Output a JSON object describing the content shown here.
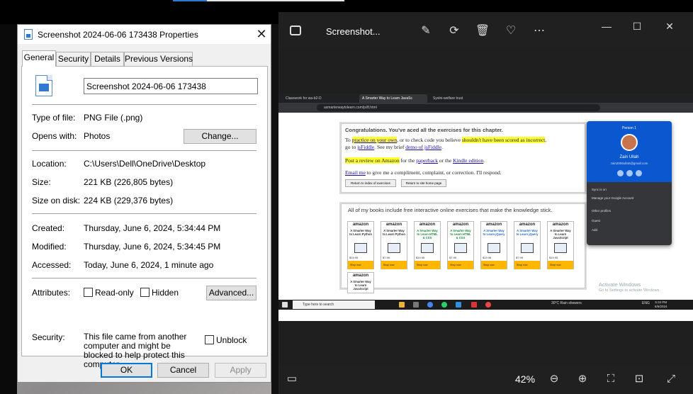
{
  "properties": {
    "title": "Screenshot 2024-06-06 173438 Properties",
    "tabs": [
      {
        "label": "General"
      },
      {
        "label": "Security"
      },
      {
        "label": "Details"
      },
      {
        "label": "Previous Versions"
      }
    ],
    "file_name": "Screenshot 2024-06-06 173438",
    "type_label": "Type of file:",
    "type_value": "PNG File (.png)",
    "opens_label": "Opens with:",
    "opens_value": "Photos",
    "change_button": "Change...",
    "location_label": "Location:",
    "location_value": "C:\\Users\\Dell\\OneDrive\\Desktop",
    "size_label": "Size:",
    "size_value": "221 KB (226,805 bytes)",
    "size_disk_label": "Size on disk:",
    "size_disk_value": "224 KB (229,376 bytes)",
    "created_label": "Created:",
    "created_value": "Thursday, June 6, 2024, 5:34:44 PM",
    "modified_label": "Modified:",
    "modified_value": "Thursday, June 6, 2024, 5:34:45 PM",
    "accessed_label": "Accessed:",
    "accessed_value": "Today, June 6, 2024, 1 minute ago",
    "attributes_label": "Attributes:",
    "readonly_label": "Read-only",
    "hidden_label": "Hidden",
    "advanced_button": "Advanced...",
    "security_label": "Security:",
    "security_text": "This file came from another computer and might be blocked to help protect this computer.",
    "unblock_label": "Unblock",
    "ok_button": "OK",
    "cancel_button": "Cancel",
    "apply_button": "Apply",
    "accent_color": "#0078d7"
  },
  "viewer": {
    "title": "Screenshot...",
    "zoom": "42%",
    "icons": [
      "image-icon",
      "edit-icon",
      "rotate-icon",
      "delete-icon",
      "favorite-icon",
      "more-icon",
      "minimize-icon",
      "maximize-icon",
      "close-icon",
      "filmstrip-icon",
      "zoom-out-icon",
      "zoom-in-icon",
      "fit-icon",
      "actual-size-icon",
      "fullscreen-icon"
    ],
    "shot": {
      "tabs": [
        "Classwork for wa-b2-D",
        "A Smarter Way to Learn JavaSc",
        "Syslni-welfare trust"
      ],
      "url": "asmarterwaytolearn.com/js/8.html",
      "card1": {
        "heading": "Congratulations. You've aced all the exercises for this chapter.",
        "to": "To",
        "practice": "practice on your own",
        "or_check": ", or to check code you believe",
        "incorrect": "shouldn't have been scored as incorrect",
        "goto": "go to",
        "jsfiddle": "jsFiddle",
        "see_brief": ". See my brief",
        "demo": "demo of jsFiddle",
        "review": "Post a review on Amazon",
        "for_the": "for the",
        "paperback": "paperback",
        "or_the": "or the",
        "kindle": "Kindle edition",
        "email": "Email me",
        "email_rest": "to give me a compliment, complaint, or correction. I'll respond.",
        "btn_index": "Return to index of exercises",
        "btn_home": "Return to site home page"
      },
      "card2": {
        "heading": "All of my books include free interactive online exercises that make the knowledge stick.",
        "books": [
          {
            "brand": "amazon",
            "title": "A Smarter Way to Learn Python",
            "price": "$19.95",
            "shop": "Shop now"
          },
          {
            "brand": "amazon",
            "title": "A Smarter Way to Learn Python",
            "price": "$7.99",
            "shop": "Shop now"
          },
          {
            "brand": "amazon",
            "title": "A Smarter Way to Learn HTML & CSS",
            "price": "$19.95",
            "shop": "Shop now"
          },
          {
            "brand": "amazon",
            "title": "A Smarter Way to Learn HTML & CSS",
            "price": "$7.99",
            "shop": "Shop now"
          },
          {
            "brand": "amazon",
            "title": "A Smarter Way to Learn jQuery",
            "price": "$19.95",
            "shop": "Shop now"
          },
          {
            "brand": "amazon",
            "title": "A Smarter Way to Learn jQuery",
            "price": "$7.99",
            "shop": "Shop now"
          },
          {
            "brand": "amazon",
            "title": "A Smarter Way to Learn JavaScript",
            "price": "$19.95",
            "shop": "Shop now"
          },
          {
            "brand": "amazon",
            "title": "A Smarter Way to Learn JavaScript",
            "price": "",
            "shop": ""
          }
        ]
      },
      "profile": {
        "header": "Person 1",
        "name": "Zain Ullah",
        "email": "zain2006ullah@gmail.com",
        "sync": "Sync is on",
        "manage": "Manage your Google Account",
        "other": "Other profiles",
        "guest": "Guest",
        "add": "Add"
      },
      "watermark_title": "Activate Windows",
      "watermark_sub": "Go to Settings to activate Windows.",
      "taskbar_search": "Type here to search",
      "weather": "30°C  Rain showers",
      "lang": "ENG",
      "time": "5:34 PM",
      "date": "6/6/2024"
    }
  }
}
